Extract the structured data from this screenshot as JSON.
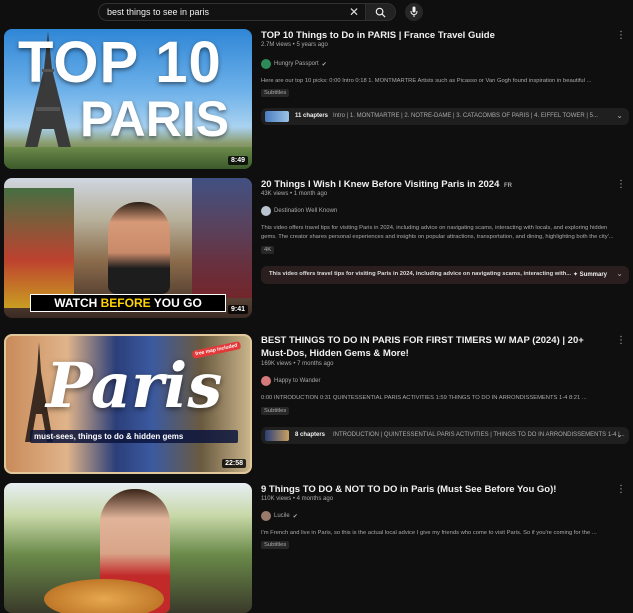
{
  "search": {
    "query": "best things to see in paris"
  },
  "results": [
    {
      "title": "TOP 10 Things to Do in PARIS | France Travel Guide",
      "meta": "2.7M views • 5 years ago",
      "channel": "Hungry Passport",
      "description": "Here are our top 10 picks: 0:00 Intro 0:18 1. MONTMARTRE Artists such as Picasso or Van Gogh found inspiration in beautiful ...",
      "badge": "Subtitles",
      "duration": "8:49",
      "thumb_line1": "TOP 10",
      "thumb_line2": "PARIS",
      "chapters_count": "11 chapters",
      "chapters_text": "Intro | 1. MONTMARTRE | 2. NOTRE-DAME | 3. CATACOMBS OF PARIS | 4. EIFFEL TOWER | 5..."
    },
    {
      "title": "20 Things I Wish I Knew Before Visiting Paris in 2024",
      "title_suffix": "FR",
      "meta": "43K views • 1 month ago",
      "channel": "Destination Well Known",
      "description": "This video offers travel tips for visiting Paris in 2024, including advice on navigating scams, interacting with locals, and exploring hidden gems. The creator shares personal experiences and insights on popular attractions, transportation, and dining, highlighting both the city'...",
      "badge": "4K",
      "duration": "9:41",
      "thumb_banner_a": "WATCH ",
      "thumb_banner_b": "BEFORE",
      "thumb_banner_c": " YOU GO",
      "summary_text": "This video offers travel tips for visiting Paris in 2024, including advice on navigating scams, interacting with...",
      "summary_label": "✦ Summary"
    },
    {
      "title": "BEST THINGS TO DO IN PARIS FOR FIRST TIMERS W/ MAP (2024) | 20+ Must-Dos, Hidden Gems & More!",
      "meta": "169K views • 7 months ago",
      "channel": "Happy to Wander",
      "description": "0:00 INTRODUCTION 0:31 QUINTESSENTIAL PARIS ACTIVITIES 1:59 THINGS TO DO IN ARRONDISSEMENTS 1-4 8:21 ...",
      "badge": "Subtitles",
      "duration": "22:58",
      "thumb_script": "Paris",
      "thumb_sub": "must-sees, things to do & hidden gems",
      "thumb_tag": "free map included",
      "chapters_count": "8 chapters",
      "chapters_text": "INTRODUCTION | QUINTESSENTIAL PARIS ACTIVITIES | THINGS TO DO IN ARRONDISSEMENTS 1-4 |..."
    },
    {
      "title": "9 Things TO DO & NOT TO DO in Paris (Must See Before You Go)!",
      "meta": "110K views • 4 months ago",
      "channel": "Lucile",
      "description": "I'm French and live in Paris, so this is the actual local advice I give my friends who come to visit Paris. So if you're coming for the ...",
      "badge": "Subtitles"
    }
  ],
  "colors": {
    "accent": "#3ea6ff",
    "banner_yellow": "#ffd400",
    "avatar_green": "#2e8b57"
  }
}
